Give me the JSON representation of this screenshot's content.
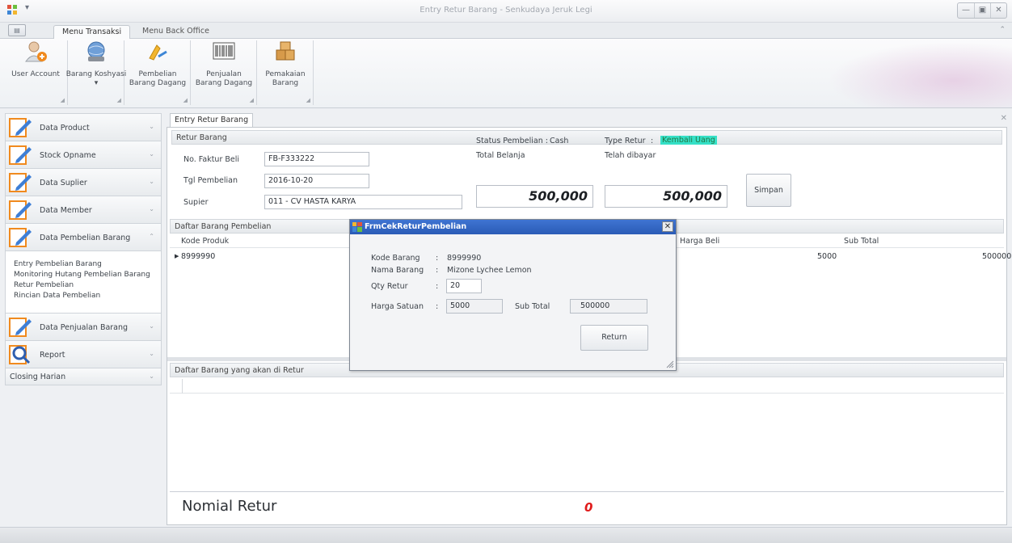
{
  "window": {
    "title": "Entry Retur Barang - Senkudaya Jeruk Legi"
  },
  "ribbon": {
    "tabs": [
      "Menu Transaksi",
      "Menu Back Office"
    ],
    "buttons": [
      {
        "label": "User Account",
        "icon": "user-add-icon"
      },
      {
        "label": "Barang Koshyasi ▾",
        "icon": "globe-icon"
      },
      {
        "label": "Pembelian Barang Dagang",
        "icon": "purchase-icon"
      },
      {
        "label": "Penjualan Barang Dagang",
        "icon": "barcode-icon"
      },
      {
        "label": "Pemakaian Barang",
        "icon": "boxes-icon"
      }
    ]
  },
  "sidebar": {
    "groups": [
      {
        "label": "Data Product",
        "expanded": false
      },
      {
        "label": "Stock Opname",
        "expanded": false
      },
      {
        "label": "Data Suplier",
        "expanded": false
      },
      {
        "label": "Data Member",
        "expanded": false
      },
      {
        "label": "Data Pembelian Barang",
        "expanded": true,
        "items": [
          "Entry Pembelian Barang",
          "Monitoring Hutang Pembelian Barang",
          "Retur Pembelian",
          "Rincian Data Pembelian"
        ]
      },
      {
        "label": "Data Penjualan Barang",
        "expanded": false
      },
      {
        "label": "Report",
        "expanded": false
      },
      {
        "label": "Closing Harian",
        "expanded": false
      }
    ]
  },
  "document": {
    "tab_label": "Entry Retur Barang",
    "retur_section": "Retur Barang",
    "form": {
      "faktur_label": "No. Faktur Beli",
      "faktur_value": "FB-F333222",
      "tgl_label": "Tgl Pembelian",
      "tgl_value": "2016-10-20",
      "supplier_label": "Supier",
      "supplier_value": "011 - CV HASTA KARYA",
      "status_label": "Status Pembelian :",
      "status_value": "Cash",
      "type_label": "Type Retur",
      "type_sep": ":",
      "type_value": "Kembali Uang",
      "total_label": "Total Belanja",
      "total_value": "500,000",
      "paid_label": "Telah dibayar",
      "paid_value": "500,000",
      "save_button": "Simpan"
    },
    "purchase_list": {
      "title": "Daftar Barang Pembelian",
      "columns": [
        "Kode Produk",
        "Harga Beli",
        "Sub Total"
      ],
      "rows": [
        {
          "kode": "8999990",
          "harga": "5000",
          "subtotal": "500000"
        }
      ]
    },
    "return_list": {
      "title": "Daftar Barang yang akan di Retur"
    },
    "nominal": {
      "label": "Nomial Retur",
      "value": "0"
    }
  },
  "dialog": {
    "title": "FrmCekReturPembelian",
    "kode_label": "Kode Barang",
    "kode_value": "8999990",
    "nama_label": "Nama Barang",
    "nama_value": "Mizone Lychee Lemon",
    "qty_label": "Qty Retur",
    "qty_value": "20",
    "harga_label": "Harga Satuan",
    "harga_value": "5000",
    "sub_label": "Sub Total",
    "sub_value": "500000",
    "sep": ":",
    "return_button": "Return"
  }
}
